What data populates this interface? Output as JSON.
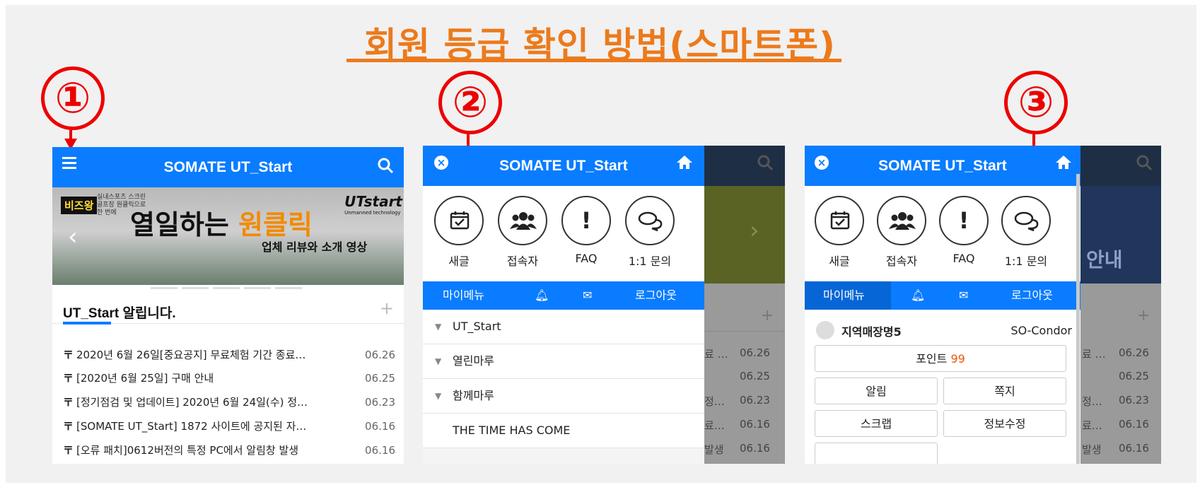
{
  "title": "회원 등급 확인 방법(스마트폰)",
  "steps": [
    "①",
    "②",
    "③"
  ],
  "app_title": "SOMATE UT_Start",
  "colors": {
    "accent": "#ec7a1c",
    "brand_blue": "#0a7cff",
    "marker_red": "#e00000"
  },
  "panel1": {
    "banner": {
      "badge": "비즈왕",
      "badge_sub": "실내스포츠 스크린 골프장 원클릭으로 한 번에",
      "headline_a": "열일하는 ",
      "headline_b": "원클릭",
      "sub": "업체 리뷰와 소개 영상",
      "logo": "UTstart",
      "logo_sub": "Unmanned technology"
    },
    "notice_title": "UT_Start 알립니다.",
    "notices": [
      {
        "text": "2020년 6월 26일[중요공지] 무료체험 기간 종료…",
        "date": "06.26"
      },
      {
        "text": "[2020년 6월 25일] 구매 안내",
        "date": "06.25"
      },
      {
        "text": "[정기점검 및 업데이트] 2020년 6월 24일(수) 정…",
        "date": "06.23"
      },
      {
        "text": "[SOMATE UT_Start] 1872 사이트에 공지된 자…",
        "date": "06.16"
      },
      {
        "text": "[오류 패치]0612버전의 특정 PC에서 알림창 발생",
        "date": "06.16"
      }
    ]
  },
  "menu": {
    "icons": [
      "새글",
      "접속자",
      "FAQ",
      "1:1 문의"
    ],
    "bar": {
      "my_menu": "마이메뉴",
      "logout": "로그아웃"
    },
    "items": [
      "UT_Start",
      "열린마루",
      "함께마루",
      "THE TIME HAS COME"
    ],
    "bg_dates": [
      "06.26",
      "06.25",
      "06.23",
      "06.16",
      "06.16"
    ],
    "bg_frag": [
      "료 …",
      "",
      "정…",
      "료…",
      "발생"
    ]
  },
  "panel3": {
    "member_name": "지역매장명5",
    "grade": "SO-Condor",
    "point_label": "포인트 ",
    "point_value": "99",
    "buttons": [
      "알림",
      "쪽지",
      "스크랩",
      "정보수정"
    ],
    "bg_text": "안내"
  }
}
